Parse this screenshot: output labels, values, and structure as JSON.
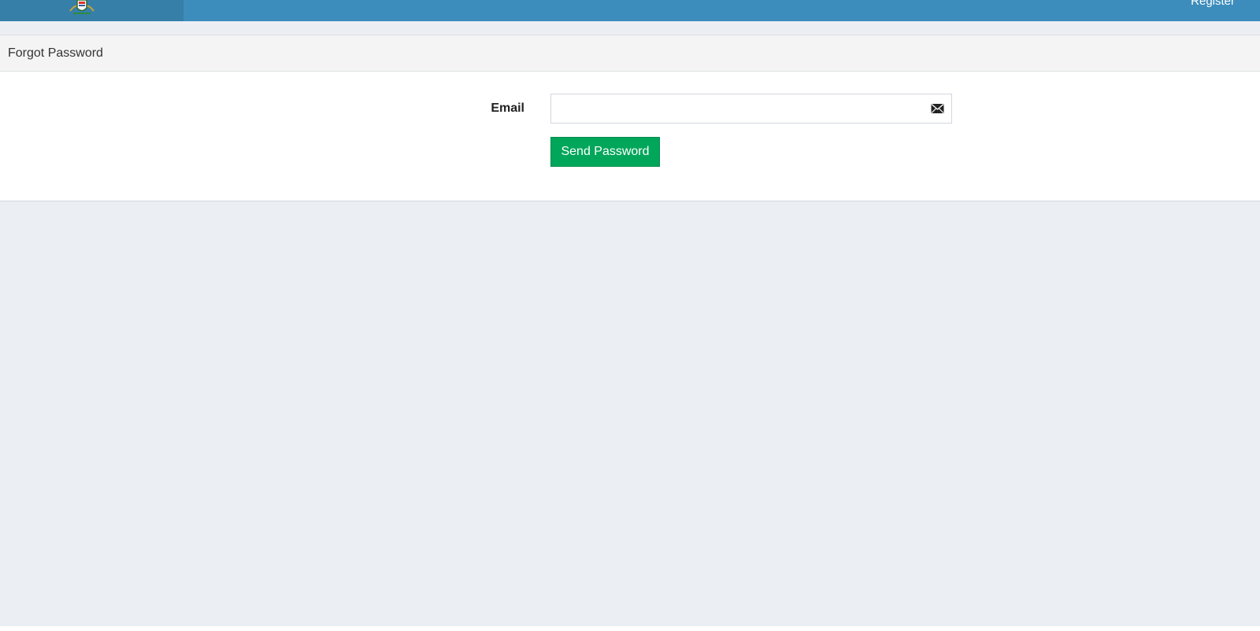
{
  "header": {
    "logo_icon": "coat-of-arms-emblem",
    "register_label": "Register",
    "bar_color": "#3c8dbc",
    "logo_bg_color": "#367fa9"
  },
  "panel": {
    "title": "Forgot Password"
  },
  "form": {
    "email_label": "Email",
    "email_value": "",
    "email_placeholder": "",
    "email_icon": "envelope-icon",
    "submit_label": "Send Password",
    "submit_color": "#00a65a"
  }
}
